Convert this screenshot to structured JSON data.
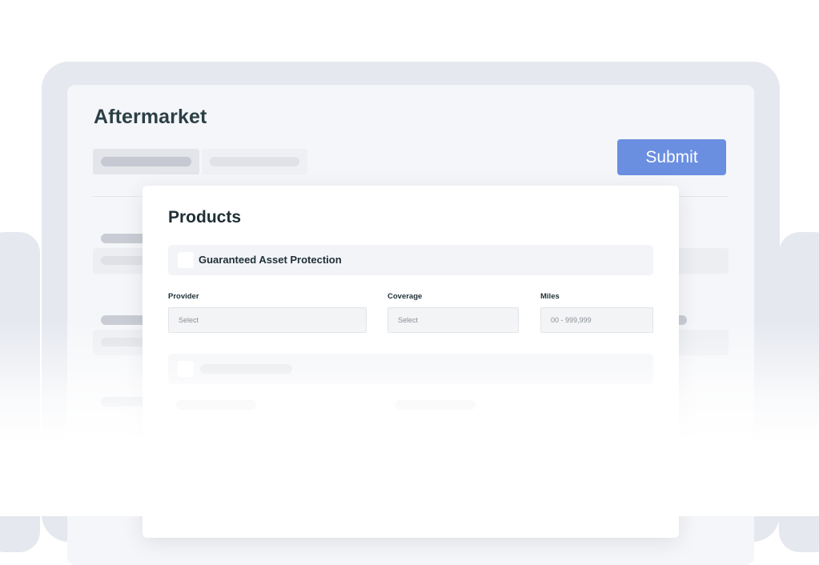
{
  "app": {
    "title": "Aftermarket",
    "submit_label": "Submit"
  },
  "products": {
    "title": "Products",
    "items": [
      {
        "label": "Guaranteed Asset Protection",
        "checked": false
      },
      {
        "label": "",
        "checked": false
      }
    ],
    "fields": {
      "provider": {
        "label": "Provider",
        "placeholder": "Select"
      },
      "coverage": {
        "label": "Coverage",
        "placeholder": "Select"
      },
      "miles": {
        "label": "Miles",
        "placeholder": "00 - 999,999"
      }
    }
  },
  "colors": {
    "accent": "#6b8fe0",
    "title_text": "#2b3f47",
    "frame": "#e5e8ef"
  }
}
